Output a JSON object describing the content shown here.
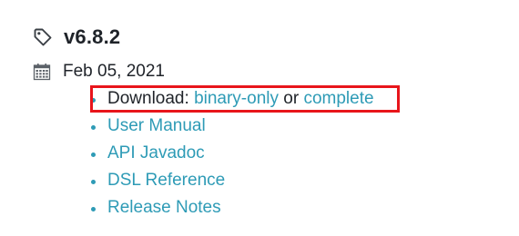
{
  "release": {
    "version": "v6.8.2",
    "date": "Feb 05, 2021",
    "tag_icon": "tag-icon",
    "calendar_icon": "calendar-icon"
  },
  "download": {
    "label": "Download:",
    "binary_label": "binary-only",
    "or_text": "or",
    "complete_label": "complete"
  },
  "links": {
    "user_manual": "User Manual",
    "api_javadoc": "API Javadoc",
    "dsl_reference": "DSL Reference",
    "release_notes": "Release Notes"
  },
  "colors": {
    "link": "#2e9bb6",
    "text": "#1f2329",
    "highlight": "#e8151b"
  }
}
